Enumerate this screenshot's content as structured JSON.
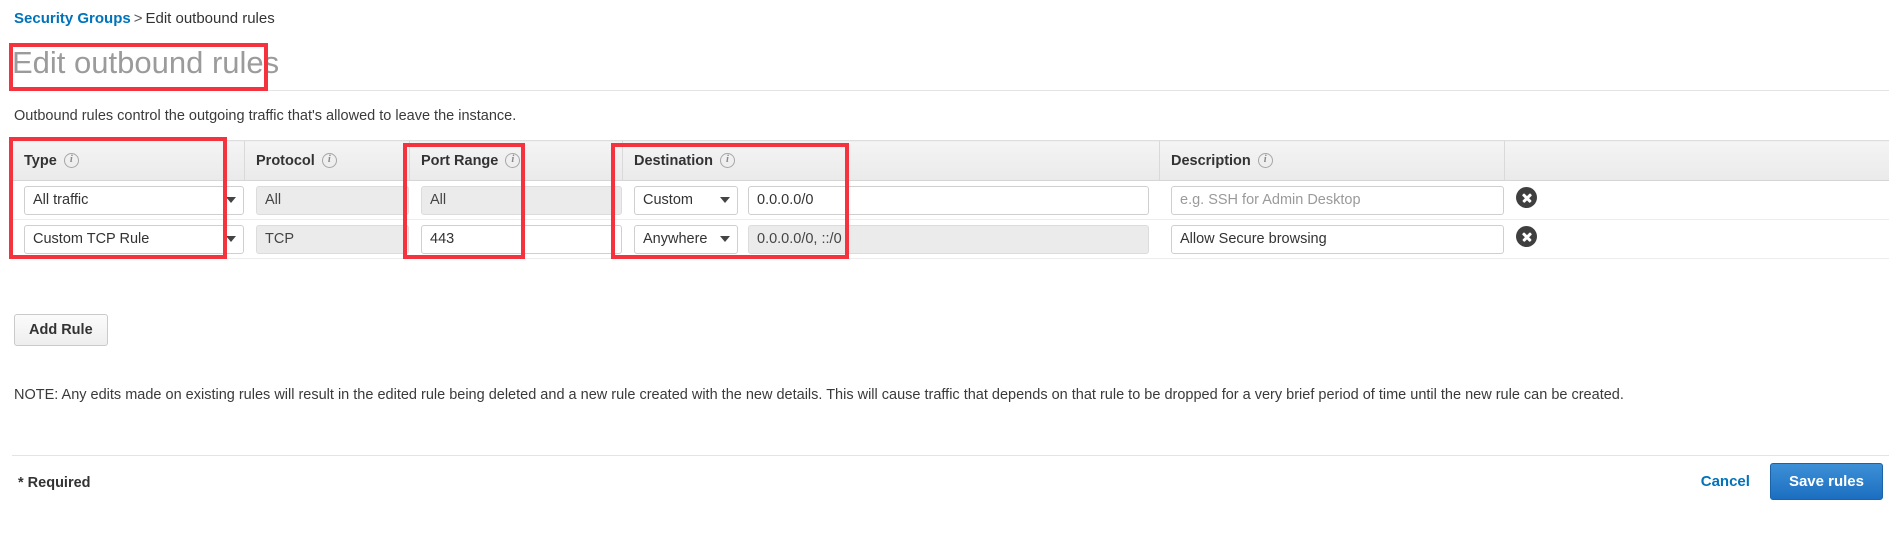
{
  "breadcrumb": {
    "link": "Security Groups",
    "separator": ">",
    "current": "Edit outbound rules"
  },
  "page_title": "Edit outbound rules",
  "intro": "Outbound rules control the outgoing traffic that's allowed to leave the instance.",
  "table": {
    "columns": [
      {
        "label": "Type",
        "info_icon": "info-icon"
      },
      {
        "label": "Protocol",
        "info_icon": "info-icon"
      },
      {
        "label": "Port Range",
        "info_icon": "info-icon"
      },
      {
        "label": "Destination",
        "info_icon": "info-icon"
      },
      {
        "label": "Description",
        "info_icon": "info-icon"
      }
    ],
    "rows": [
      {
        "type": "All traffic",
        "protocol": "All",
        "protocol_disabled": true,
        "port_range": "All",
        "port_range_disabled": true,
        "destination_select": "Custom",
        "destination_value": "0.0.0.0/0",
        "destination_disabled": false,
        "description_value": "",
        "description_placeholder": "e.g. SSH for Admin Desktop",
        "delete_icon": "close-circle-icon"
      },
      {
        "type": "Custom TCP Rule",
        "protocol": "TCP",
        "protocol_disabled": true,
        "port_range": "443",
        "port_range_disabled": false,
        "destination_select": "Anywhere",
        "destination_value": "0.0.0.0/0, ::/0",
        "destination_disabled": true,
        "description_value": "Allow Secure browsing",
        "description_placeholder": "e.g. SSH for Admin Desktop",
        "delete_icon": "close-circle-icon"
      }
    ]
  },
  "add_rule_label": "Add Rule",
  "note": "NOTE: Any edits made on existing rules will result in the edited rule being deleted and a new rule created with the new details. This will cause traffic that depends on that rule to be dropped for a very brief period of time until the new rule can be created.",
  "footer": {
    "required_label": "* Required",
    "cancel_label": "Cancel",
    "save_label": "Save rules"
  },
  "colors": {
    "link": "#0073bb",
    "primary_button": "#1c6fc0",
    "annotation": "#f5333f",
    "title_gray": "#9b9b9b"
  }
}
